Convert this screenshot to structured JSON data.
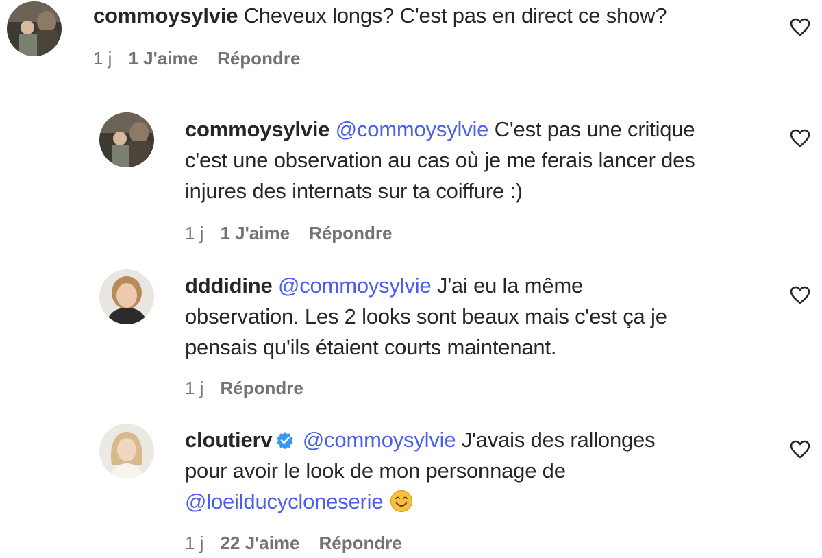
{
  "comments": [
    {
      "username": "commoysylvie",
      "text": "Cheveux longs? C'est pas en direct ce show?",
      "time": "1 j",
      "likes": "1 J'aime",
      "reply": "Répondre",
      "avatar": "family-photo-avatar"
    },
    {
      "username": "commoysylvie",
      "mention": "@commoysylvie",
      "line1": "C'est pas une critique",
      "line2": "c'est une observation au cas où je me ferais lancer des",
      "line3": "injures des internats sur ta coiffure :)",
      "time": "1 j",
      "likes": "1 J'aime",
      "reply": "Répondre",
      "avatar": "family-photo-avatar"
    },
    {
      "username": "dddidine",
      "mention": "@commoysylvie",
      "line1": "J'ai eu la même",
      "line2": "observation. Les 2 looks sont beaux mais c'est ça je",
      "line3": "pensais qu'ils étaient courts maintenant.",
      "time": "1 j",
      "reply": "Répondre",
      "avatar": "woman-portrait-avatar"
    },
    {
      "username": "cloutierv",
      "verified": true,
      "mention": "@commoysylvie",
      "line1": "J'avais des rallonges",
      "line2": "pour avoir le look de mon personnage de",
      "mention2": "@loeilducycloneserie",
      "emoji": "smiling-face-emoji",
      "time": "1 j",
      "likes": "22 J'aime",
      "reply": "Répondre",
      "avatar": "blonde-woman-avatar"
    }
  ],
  "colors": {
    "text": "#262626",
    "meta": "#737373",
    "mention": "#4a5ff0",
    "verified": "#3897f0"
  }
}
